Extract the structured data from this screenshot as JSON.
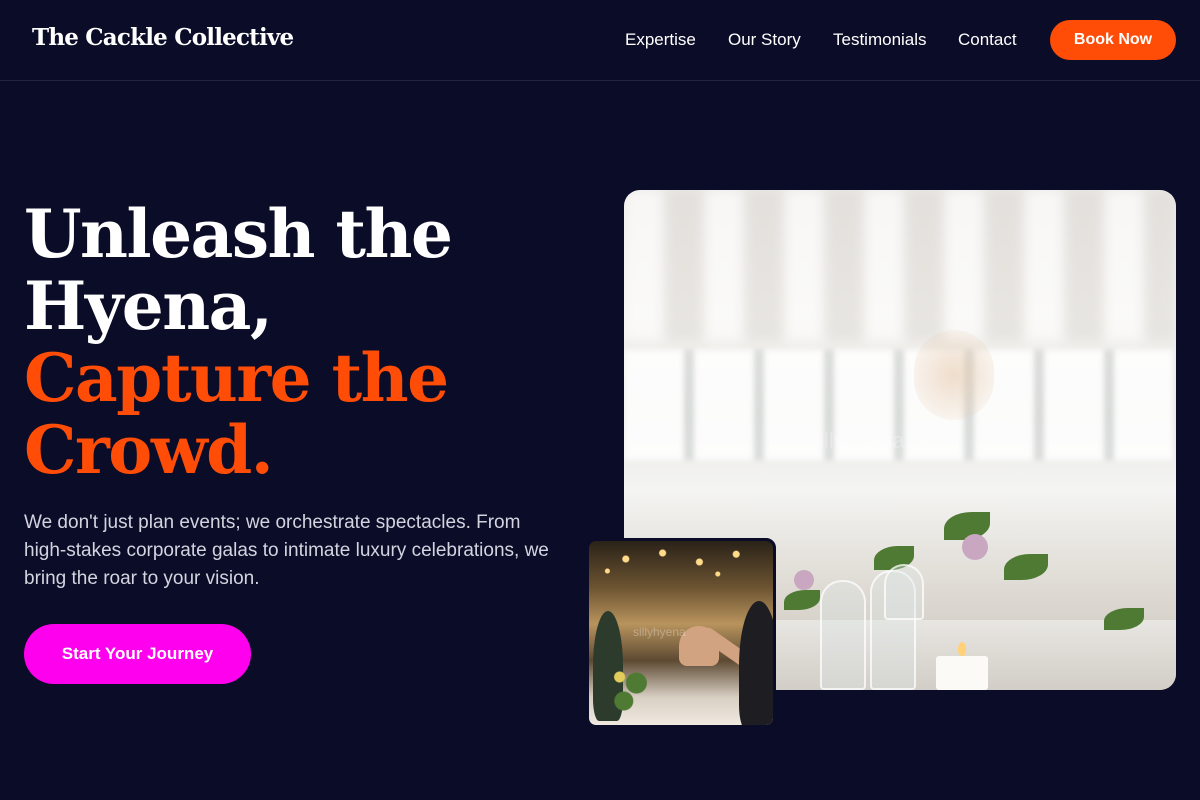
{
  "header": {
    "logo": "The Cackle Collective",
    "nav": [
      "Expertise",
      "Our Story",
      "Testimonials",
      "Contact"
    ],
    "book_label": "Book Now"
  },
  "hero": {
    "headline_lines": [
      "Unleash the",
      "Hyena,"
    ],
    "accent_lines": [
      "Capture the",
      "Crowd."
    ],
    "subtext": "We don't just plan events; we orchestrate spectacles. From high-stakes corporate galas to intimate luxury celebrations, we bring the roar to your vision.",
    "cta_label": "Start Your Journey"
  },
  "images": {
    "main_watermark": "sillyhyena.biz",
    "inset_watermark": "sillyhyena"
  },
  "colors": {
    "background": "#0b0c27",
    "accent_orange": "#ff4d07",
    "accent_magenta": "#ff00ee"
  }
}
